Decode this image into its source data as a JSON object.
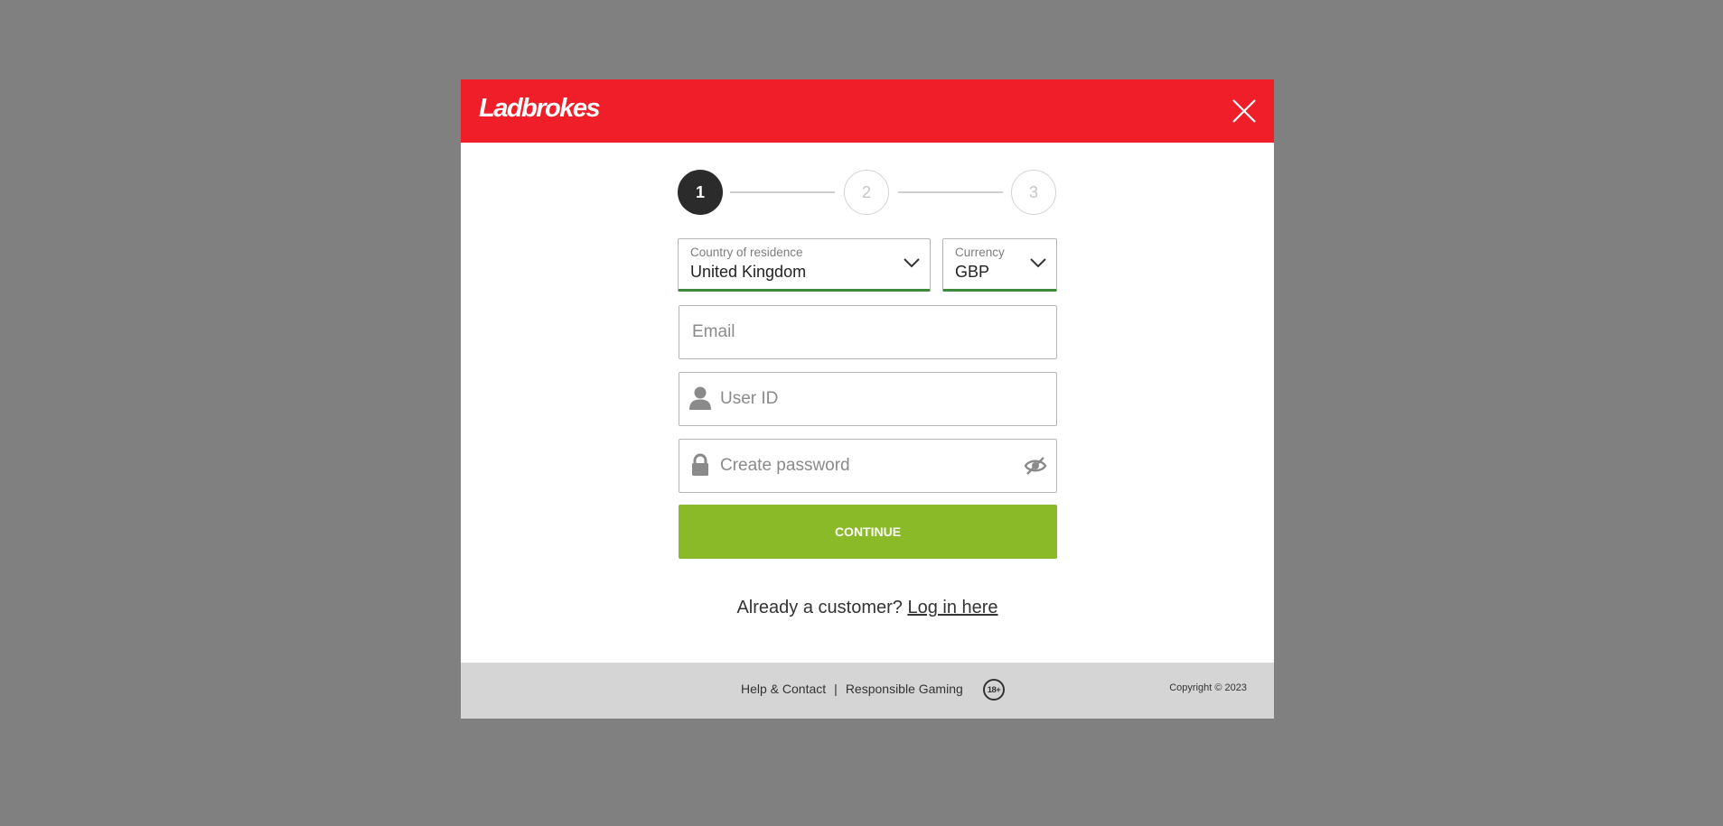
{
  "header": {
    "logo_text": "Ladbrokes",
    "background_color": "#f01e28"
  },
  "stepper": {
    "steps": [
      "1",
      "2",
      "3"
    ],
    "active_step": "1"
  },
  "form": {
    "country": {
      "label": "Country of residence",
      "value": "United Kingdom"
    },
    "currency": {
      "label": "Currency",
      "value": "GBP"
    },
    "email": {
      "placeholder": "Email"
    },
    "user_id": {
      "placeholder": "User ID"
    },
    "password": {
      "placeholder": "Create password"
    },
    "continue_label": "CONTINUE",
    "continue_color": "#8aba28",
    "valid_color": "#3d8a3d"
  },
  "login_prompt": {
    "text": "Already a customer?",
    "link_text": "Log in here"
  },
  "footer": {
    "help_link": "Help & Contact",
    "separator": "|",
    "responsible_link": "Responsible Gaming",
    "age_badge": "18+",
    "copyright": "Copyright © 2023"
  },
  "icons": {
    "close": "close-icon",
    "chevron": "chevron-down-icon",
    "user": "user-icon",
    "lock": "lock-icon",
    "eye": "eye-off-icon"
  }
}
